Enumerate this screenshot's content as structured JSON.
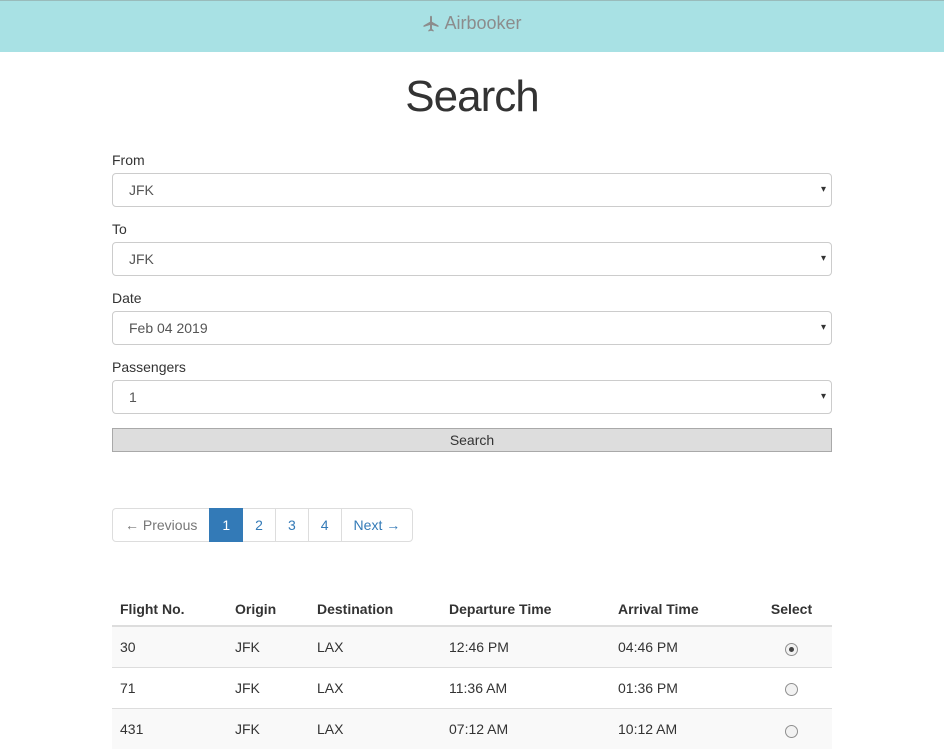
{
  "navbar": {
    "brand": "Airbooker",
    "icon": "airplane-icon"
  },
  "page": {
    "title": "Search"
  },
  "form": {
    "from": {
      "label": "From",
      "value": "JFK"
    },
    "to": {
      "label": "To",
      "value": "JFK"
    },
    "date": {
      "label": "Date",
      "value": "Feb 04 2019"
    },
    "passengers": {
      "label": "Passengers",
      "value": "1"
    },
    "search_label": "Search",
    "caret": "▾"
  },
  "pagination": {
    "prev": "← Previous",
    "pages": [
      "1",
      "2",
      "3",
      "4"
    ],
    "active": "1",
    "next": "Next →"
  },
  "table": {
    "headers": [
      "Flight No.",
      "Origin",
      "Destination",
      "Departure Time",
      "Arrival Time",
      "Select"
    ],
    "rows": [
      {
        "flight": "30",
        "origin": "JFK",
        "destination": "LAX",
        "departure": "12:46 PM",
        "arrival": "04:46 PM",
        "selected": true
      },
      {
        "flight": "71",
        "origin": "JFK",
        "destination": "LAX",
        "departure": "11:36 AM",
        "arrival": "01:36 PM",
        "selected": false
      },
      {
        "flight": "431",
        "origin": "JFK",
        "destination": "LAX",
        "departure": "07:12 AM",
        "arrival": "10:12 AM",
        "selected": false
      }
    ]
  }
}
